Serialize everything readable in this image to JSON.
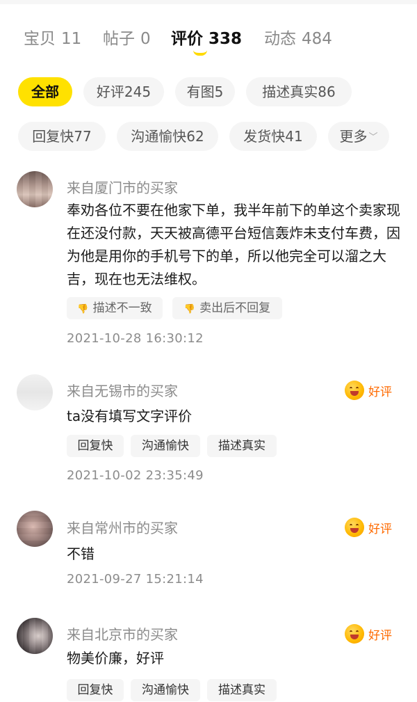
{
  "tabs": [
    {
      "label": "宝贝",
      "count": "11",
      "active": false
    },
    {
      "label": "帖子",
      "count": "0",
      "active": false
    },
    {
      "label": "评价",
      "count": "338",
      "active": true
    },
    {
      "label": "动态",
      "count": "484",
      "active": false
    }
  ],
  "filters": [
    {
      "label": "全部",
      "active": true
    },
    {
      "label": "好评245"
    },
    {
      "label": "有图5"
    },
    {
      "label": "描述真实86"
    },
    {
      "label": "回复快77"
    },
    {
      "label": "沟通愉快62"
    },
    {
      "label": "发货快41"
    },
    {
      "label": "更多"
    }
  ],
  "colors": {
    "accent": "#ffe100",
    "badge": "#ff6a00"
  },
  "reviews": [
    {
      "buyer": "来自厦门市的买家",
      "text": "奉劝各位不要在他家下单，我半年前下的单这个卖家现在还没付款，天天被高德平台短信轰炸未支付车费，因为他是用你的手机号下的单，所以他完全可以溜之大吉，现在也无法维权。",
      "tags": [
        "描述不一致",
        "卖出后不回复"
      ],
      "date": "2021-10-28 16:30:12"
    },
    {
      "buyer": "来自无锡市的买家",
      "badge": "好评",
      "text": "ta没有填写文字评价",
      "tags": [
        "回复快",
        "沟通愉快",
        "描述真实"
      ],
      "date": "2021-10-02 23:35:49"
    },
    {
      "buyer": "来自常州市的买家",
      "badge": "好评",
      "text": "不错",
      "date": "2021-09-27 15:21:14"
    },
    {
      "buyer": "来自北京市的买家",
      "badge": "好评",
      "text": "物美价廉，好评",
      "tags": [
        "回复快",
        "沟通愉快",
        "描述真实"
      ]
    }
  ]
}
